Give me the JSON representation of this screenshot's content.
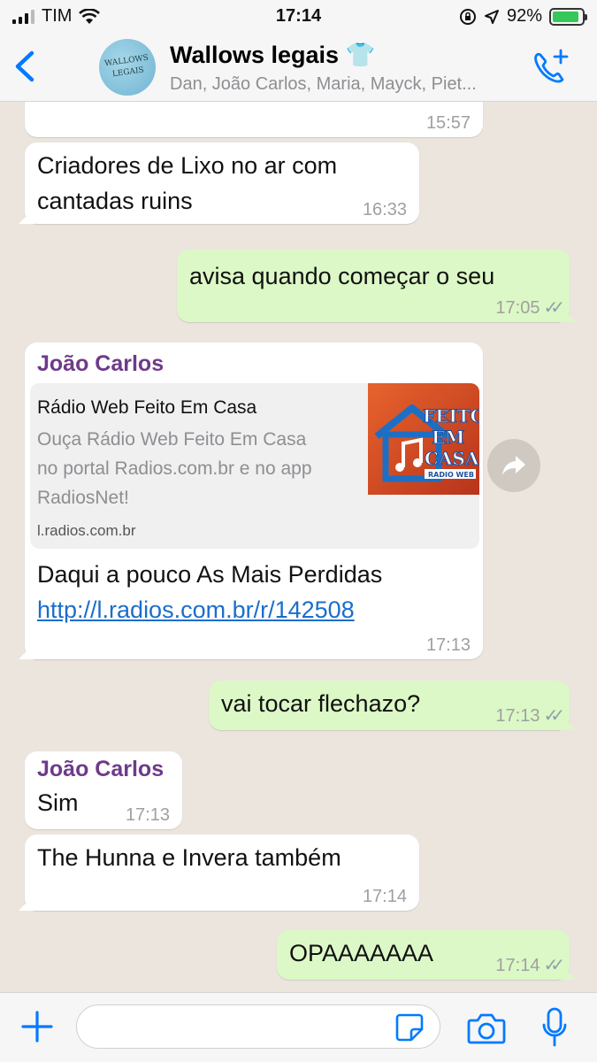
{
  "status": {
    "carrier": "TIM",
    "time": "17:14",
    "battery": "92%",
    "battery_level": 0.92
  },
  "header": {
    "title": "Wallows legais 👕",
    "subtitle": "Dan, João Carlos, Maria, Mayck, Piet...",
    "avatar_text": "WALLOWS LEGAIS",
    "icons": {
      "back": "chevron-left-icon",
      "call": "add-call-icon"
    }
  },
  "messages": [
    {
      "dir": "in",
      "text": "",
      "time": "15:57"
    },
    {
      "dir": "in",
      "line1": "Criadores de Lixo no ar com",
      "line2": "cantadas ruins",
      "time": "16:33"
    },
    {
      "dir": "out",
      "text": "avisa quando começar o seu",
      "time": "17:05",
      "status": "read"
    },
    {
      "dir": "in",
      "sender": "João Carlos",
      "preview": {
        "title": "Rádio Web Feito Em Casa",
        "desc_line1": "Ouça Rádio Web Feito Em Casa",
        "desc_line2": "no portal Radios.com.br e no app",
        "desc_line3": "RadiosNet!",
        "domain": "l.radios.com.br",
        "thumb_line1": "FEITO",
        "thumb_line2": "EM",
        "thumb_line3": "CASA",
        "thumb_line4": "RADIO WEB"
      },
      "text": "Daqui a pouco As Mais Perdidas",
      "link": "http://l.radios.com.br/r/142508",
      "time": "17:13"
    },
    {
      "dir": "out",
      "text": "vai tocar flechazo?",
      "time": "17:13",
      "status": "read"
    },
    {
      "dir": "in",
      "sender": "João Carlos",
      "text": "Sim",
      "time": "17:13"
    },
    {
      "dir": "in",
      "text": "The Hunna e Invera também",
      "time": "17:14"
    },
    {
      "dir": "out",
      "text": "OPAAAAAAA",
      "time": "17:14",
      "status": "read"
    }
  ],
  "input": {
    "placeholder": "",
    "value": ""
  },
  "colors": {
    "incoming": "#ffffff",
    "outgoing": "#dcf8c6",
    "accent": "#007aff",
    "sender": "#6e3a8a",
    "link": "#1a6ecb"
  }
}
